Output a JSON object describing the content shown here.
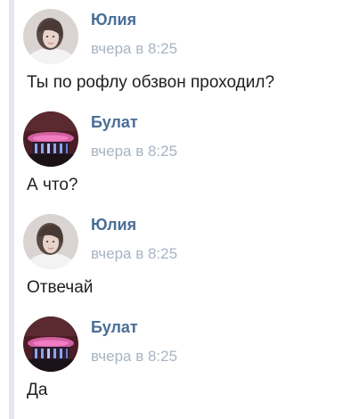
{
  "messages": [
    {
      "author": "Юлия",
      "time": "вчера в 8:25",
      "text": "Ты по рофлу обзвон проходил?",
      "avatar_icon": "user-avatar-girl"
    },
    {
      "author": "Булат",
      "time": "вчера в 8:25",
      "text": "А что?",
      "avatar_icon": "user-avatar-night-building"
    },
    {
      "author": "Юлия",
      "time": "вчера в 8:25",
      "text": "Отвечай",
      "avatar_icon": "user-avatar-girl"
    },
    {
      "author": "Булат",
      "time": "вчера в 8:25",
      "text": "Да",
      "avatar_icon": "user-avatar-night-building"
    }
  ],
  "colors": {
    "author": "#4a6e98",
    "time": "#a8b4c2",
    "text": "#1f1f1f",
    "quote_bar": "#e3e7ec"
  }
}
